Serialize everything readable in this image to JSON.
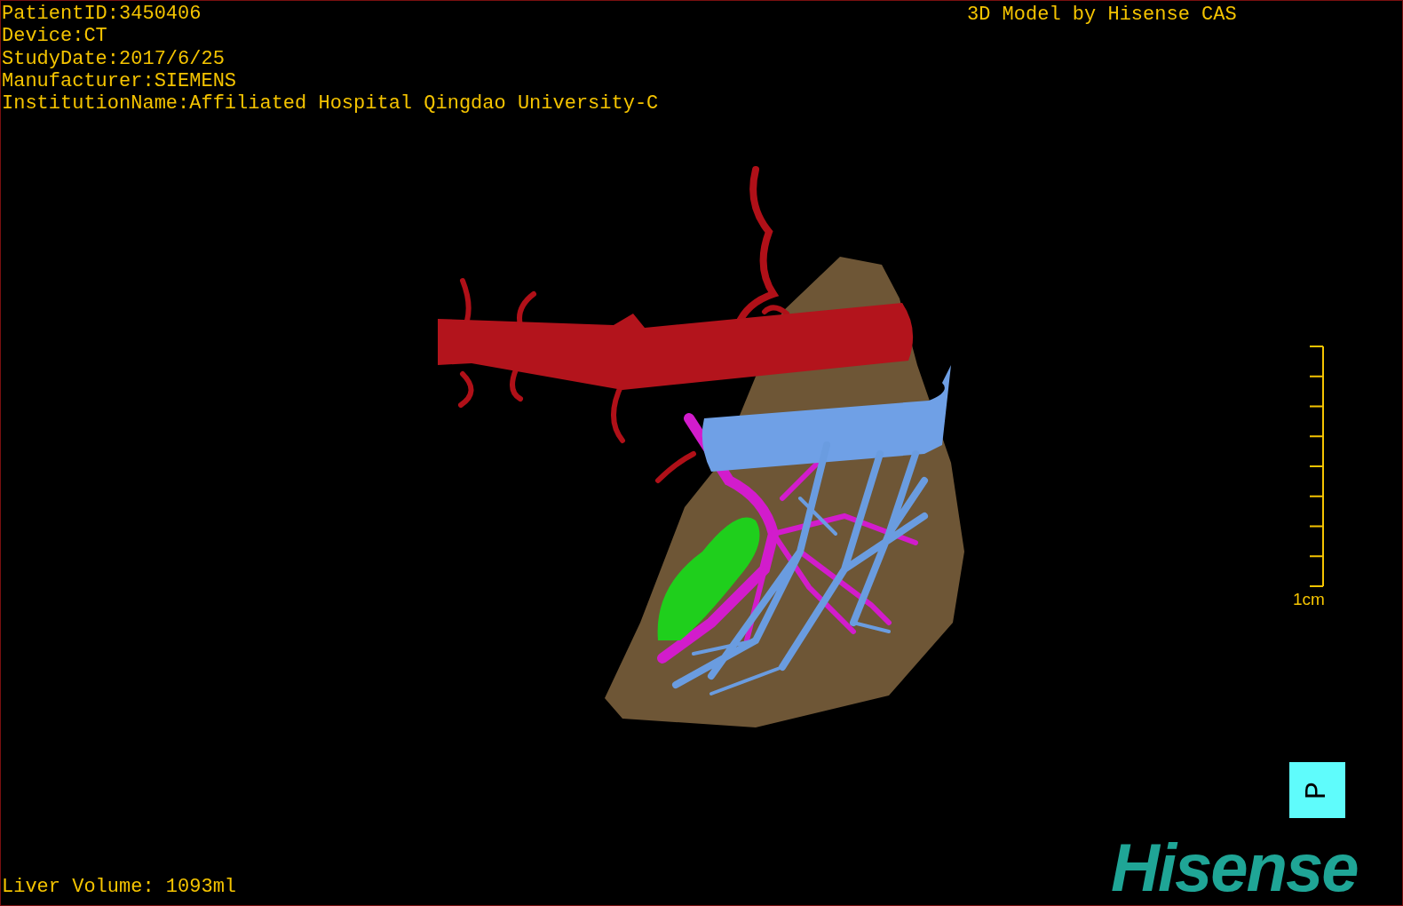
{
  "info_lines": [
    "PatientID:3450406",
    "Device:CT",
    "StudyDate:2017/6/25",
    "Manufacturer:SIEMENS",
    "InstitutionName:Affiliated Hospital Qingdao University-C"
  ],
  "title": "3D Model by Hisense CAS",
  "scale_bar": {
    "label": "1cm"
  },
  "orientation_cube": {
    "letter": "P"
  },
  "liver_volume": "Liver Volume: 1093ml",
  "logo": "Hisense"
}
